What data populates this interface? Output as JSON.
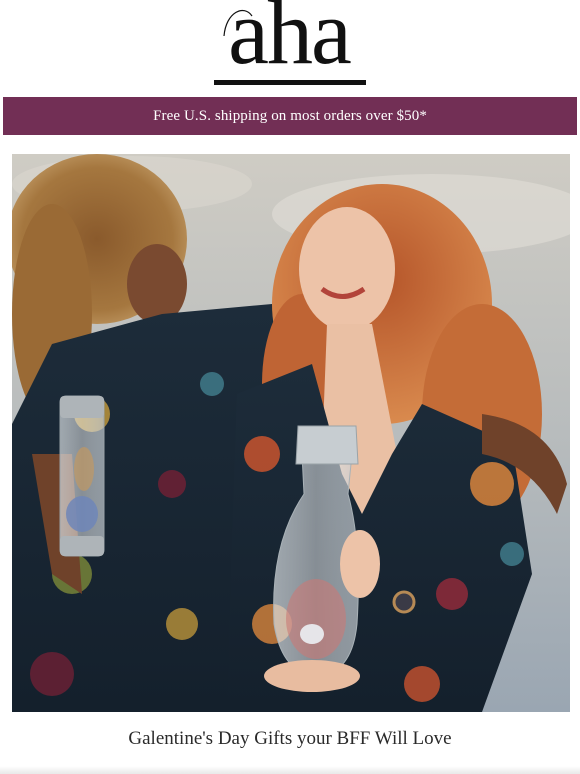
{
  "logo": {
    "text": "aha"
  },
  "banner": {
    "text": "Free U.S. shipping on most orders over $50*"
  },
  "hero": {
    "icon": "photo-two-women-with-water-carafes"
  },
  "headline": {
    "text": "Galentine's Day Gifts your BFF Will Love"
  },
  "colors": {
    "banner_bg": "#722f55",
    "banner_text": "#ffffff",
    "logo": "#111111",
    "headline": "#2a2a2a"
  }
}
